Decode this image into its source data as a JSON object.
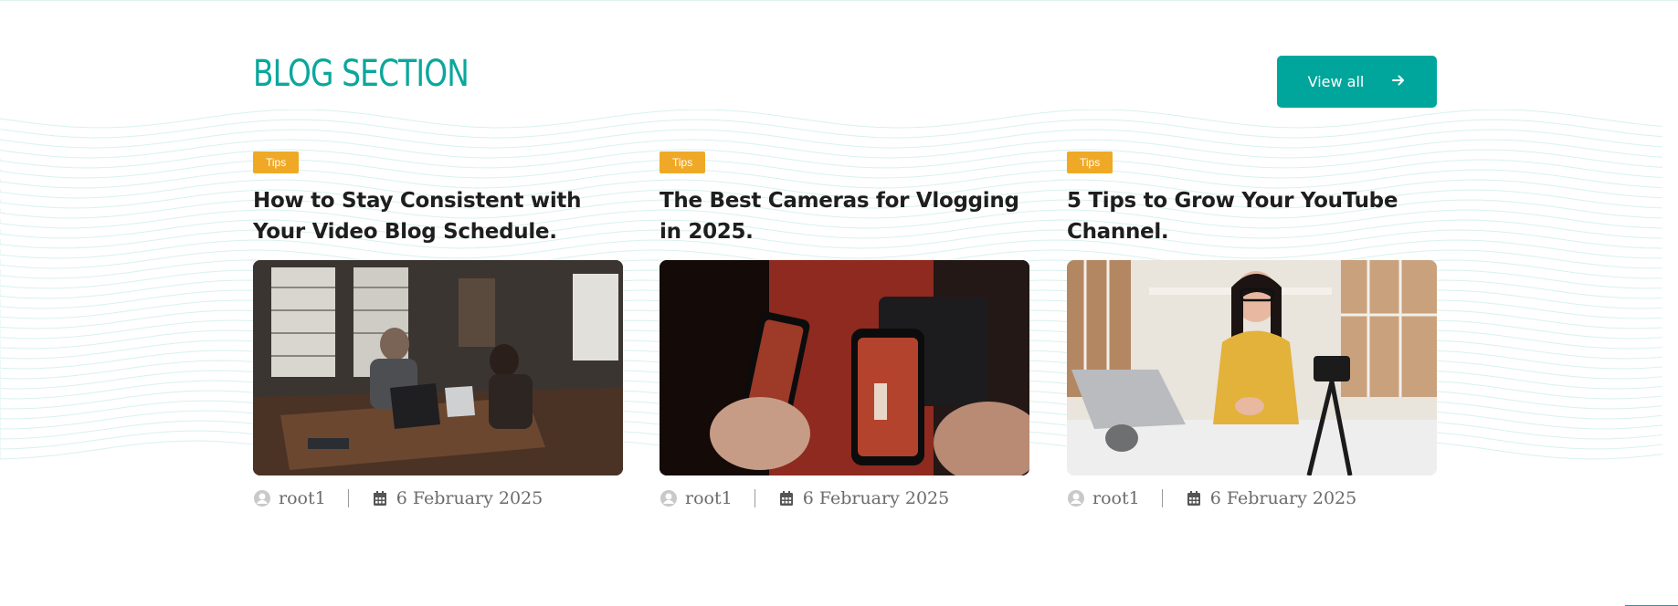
{
  "section": {
    "title": "BLOG SECTION",
    "view_all_label": "View all",
    "accent_color": "#00a69c",
    "tag_color": "#f0a926"
  },
  "posts": [
    {
      "tag": "Tips",
      "title": "How to Stay Consistent with Your Video Blog Schedule.",
      "author": "root1",
      "date": "6 February 2025",
      "image_subject": "two people working on laptops at a wooden table"
    },
    {
      "tag": "Tips",
      "title": "The Best Cameras for Vlogging in 2025.",
      "author": "root1",
      "date": "6 February 2025",
      "image_subject": "hands holding smartphones filming on a red background"
    },
    {
      "tag": "Tips",
      "title": "5 Tips to Grow Your YouTube Channel.",
      "author": "root1",
      "date": "6 February 2025",
      "image_subject": "smiling woman with glasses recording a makeup video"
    }
  ]
}
